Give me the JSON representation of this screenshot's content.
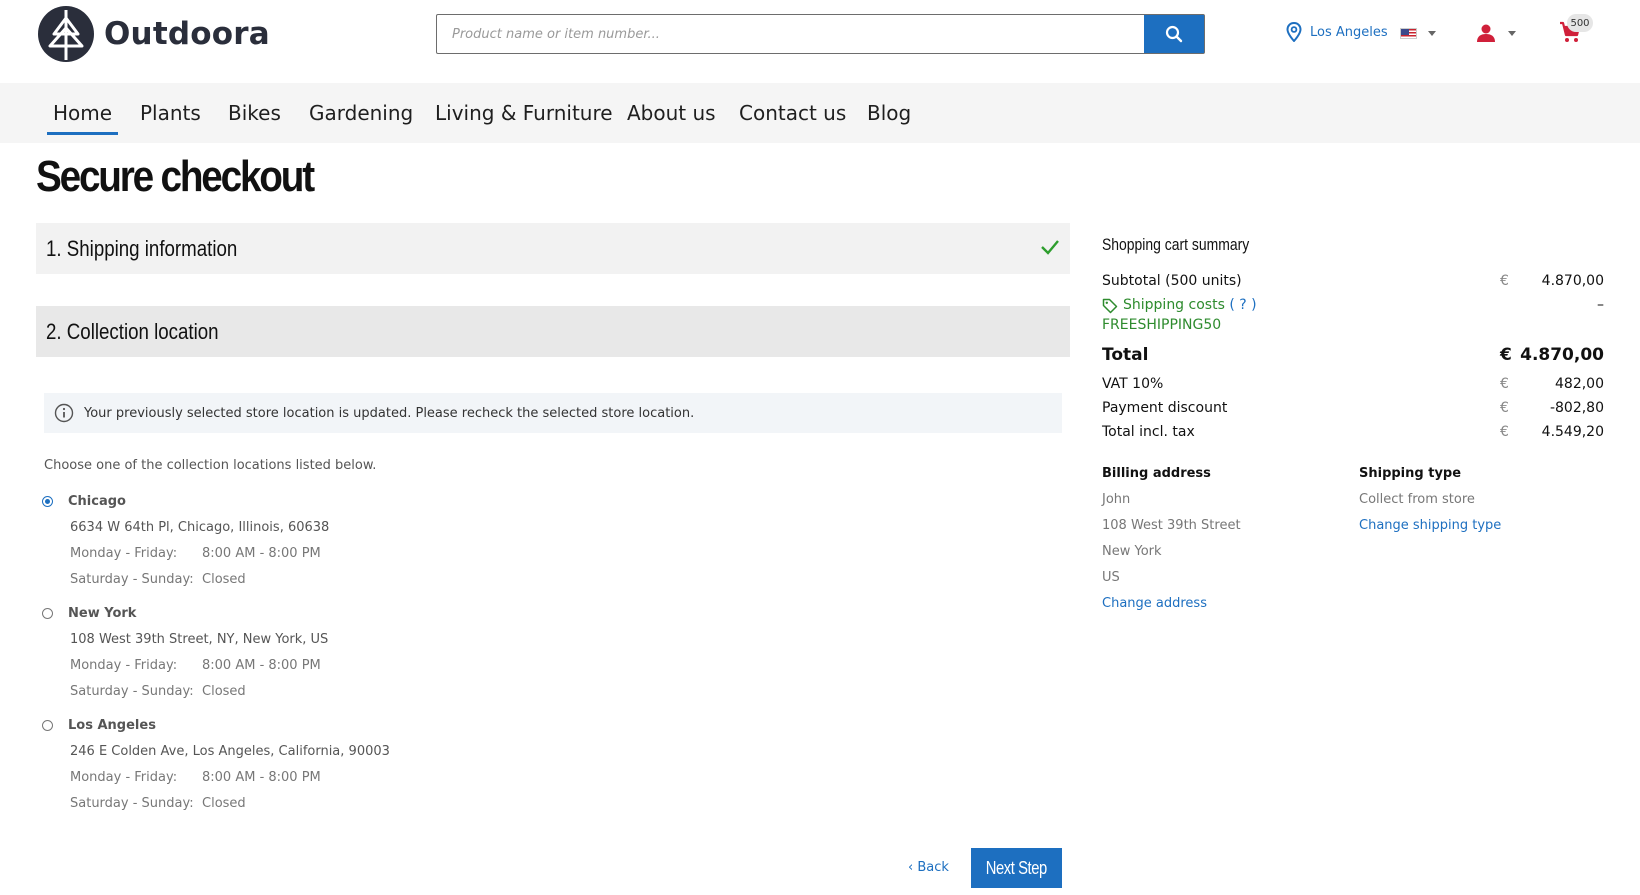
{
  "brand": {
    "name": "Outdoora"
  },
  "search": {
    "placeholder": "Product name or item number..."
  },
  "header": {
    "location": "Los Angeles",
    "cart_count": "500"
  },
  "nav": {
    "items": [
      "Home",
      "Plants",
      "Bikes",
      "Gardening",
      "Living & Furniture",
      "About us",
      "Contact us",
      "Blog"
    ],
    "active": "Home"
  },
  "page": {
    "title": "Secure checkout"
  },
  "steps": [
    {
      "label": "1.  Shipping information",
      "completed": true
    },
    {
      "label": "2.  Collection location",
      "completed": false
    }
  ],
  "notice": {
    "text": "Your previously selected store location is updated. Please recheck the selected store location."
  },
  "collection": {
    "intro": "Choose one of the collection locations listed below.",
    "stores": [
      {
        "name": "Chicago",
        "address": "6634 W 64th Pl, Chicago, Illinois, 60638",
        "hours": [
          {
            "days": "Monday - Friday:",
            "time": "8:00 AM - 8:00 PM"
          },
          {
            "days": "Saturday - Sunday:",
            "time": "Closed"
          }
        ],
        "selected": true
      },
      {
        "name": "New York",
        "address": "108 West 39th Street, NY, New York, US",
        "hours": [
          {
            "days": "Monday - Friday:",
            "time": "8:00 AM - 8:00 PM"
          },
          {
            "days": "Saturday - Sunday:",
            "time": "Closed"
          }
        ],
        "selected": false
      },
      {
        "name": "Los Angeles",
        "address": "246 E Colden Ave, Los Angeles, California, 90003",
        "hours": [
          {
            "days": "Monday - Friday:",
            "time": "8:00 AM - 8:00 PM"
          },
          {
            "days": "Saturday - Sunday:",
            "time": "Closed"
          }
        ],
        "selected": false
      }
    ]
  },
  "buttons": {
    "back": "‹ Back",
    "next": "Next Step"
  },
  "summary": {
    "title": "Shopping cart summary",
    "currency": "€",
    "subtotal_label": "Subtotal (500 units)",
    "subtotal": "4.870,00",
    "shipping_label": "Shipping costs",
    "shipping_help": "( ? )",
    "shipping_value": "–",
    "coupon": "FREESHIPPING50",
    "total_label": "Total",
    "total": "4.870,00",
    "vat_label": "VAT 10%",
    "vat": "482,00",
    "discount_label": "Payment discount",
    "discount": "-802,80",
    "incl_label": "Total incl. tax",
    "incl": "4.549,20"
  },
  "billing": {
    "heading": "Billing address",
    "name": "John",
    "street": "108 West 39th Street",
    "city": "New York",
    "country": "US",
    "change": "Change address"
  },
  "shipping_type": {
    "heading": "Shipping type",
    "value": "Collect from store",
    "change": "Change shipping type"
  },
  "colors": {
    "accent": "#1d6fc0",
    "success": "#2e8b2e",
    "cart_red": "#d0203a"
  }
}
